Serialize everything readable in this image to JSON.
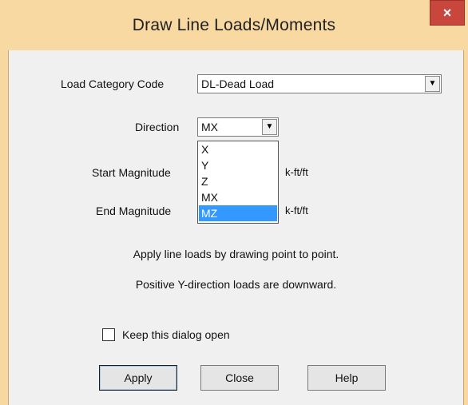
{
  "dialog": {
    "title": "Draw Line Loads/Moments",
    "close_glyph": "×"
  },
  "fields": {
    "load_category_label": "Load Category Code",
    "load_category_value": "DL-Dead Load",
    "direction_label": "Direction",
    "direction_value": "MX",
    "start_magnitude_label": "Start Magnitude",
    "start_magnitude_unit": "k-ft/ft",
    "end_magnitude_label": "End Magnitude",
    "end_magnitude_unit": "k-ft/ft"
  },
  "direction_options": [
    "X",
    "Y",
    "Z",
    "MX",
    "MZ"
  ],
  "direction_highlighted": "MZ",
  "info": {
    "line1": "Apply line loads by drawing point to point.",
    "line2": "Positive Y-direction loads are downward."
  },
  "keep_open": {
    "label": "Keep this dialog open",
    "checked": false
  },
  "buttons": {
    "apply": "Apply",
    "close": "Close",
    "help": "Help"
  },
  "icons": {
    "combo_arrow": "dropdown-arrow-icon",
    "close": "close-icon"
  }
}
